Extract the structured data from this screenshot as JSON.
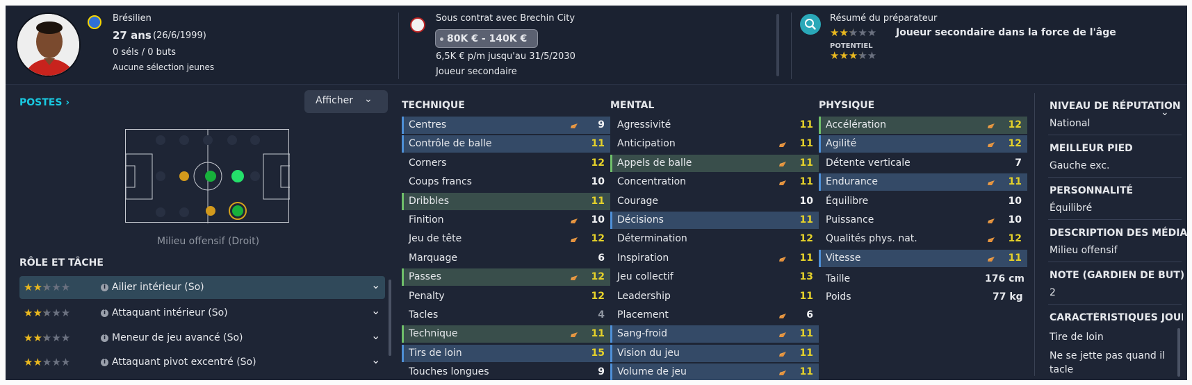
{
  "player": {
    "nationality": "Brésilien",
    "age": "27 ans",
    "dob": "(26/6/1999)",
    "caps": "0 séls / 0 buts",
    "youth": "Aucune sélection jeunes"
  },
  "contract": {
    "status": "Sous contrat avec Brechin City",
    "wage_range": "80K € - 140K €",
    "wage": "6,5K € p/m jusqu'au 31/5/2030",
    "role": "Joueur secondaire"
  },
  "scout": {
    "title": "Résumé du préparateur",
    "summary": "Joueur secondaire dans la force de l'âge",
    "ability_stars": 2.5,
    "potential_label": "POTENTIEL",
    "potential_stars": 3.5
  },
  "positions": {
    "title": "POSTES",
    "show_button": "Afficher",
    "position_label": "Milieu offensif (Droit)"
  },
  "roles": {
    "title": "RÔLE ET TÂCHE",
    "items": [
      {
        "label": "Ailier intérieur (So)",
        "stars": 2.5
      },
      {
        "label": "Attaquant intérieur (So)",
        "stars": 2.5
      },
      {
        "label": "Meneur de jeu avancé (So)",
        "stars": 2.5
      },
      {
        "label": "Attaquant pivot excentré (So)",
        "stars": 2
      }
    ]
  },
  "attributes": {
    "technical": {
      "title": "TECHNIQUE",
      "rows": [
        {
          "name": "Centres",
          "value": "9"
        },
        {
          "name": "Contrôle de balle",
          "value": "11"
        },
        {
          "name": "Corners",
          "value": "12"
        },
        {
          "name": "Coups francs",
          "value": "10"
        },
        {
          "name": "Dribbles",
          "value": "11"
        },
        {
          "name": "Finition",
          "value": "10"
        },
        {
          "name": "Jeu de tête",
          "value": "12"
        },
        {
          "name": "Marquage",
          "value": "6"
        },
        {
          "name": "Passes",
          "value": "12"
        },
        {
          "name": "Penalty",
          "value": "12"
        },
        {
          "name": "Tacles",
          "value": "4"
        },
        {
          "name": "Technique",
          "value": "11"
        },
        {
          "name": "Tirs de loin",
          "value": "15"
        },
        {
          "name": "Touches longues",
          "value": "9"
        }
      ]
    },
    "mental": {
      "title": "MENTAL",
      "rows": [
        {
          "name": "Agressivité",
          "value": "11"
        },
        {
          "name": "Anticipation",
          "value": "11"
        },
        {
          "name": "Appels de balle",
          "value": "11"
        },
        {
          "name": "Concentration",
          "value": "11"
        },
        {
          "name": "Courage",
          "value": "10"
        },
        {
          "name": "Décisions",
          "value": "11"
        },
        {
          "name": "Détermination",
          "value": "12"
        },
        {
          "name": "Inspiration",
          "value": "11"
        },
        {
          "name": "Jeu collectif",
          "value": "13"
        },
        {
          "name": "Leadership",
          "value": "11"
        },
        {
          "name": "Placement",
          "value": "6"
        },
        {
          "name": "Sang-froid",
          "value": "11"
        },
        {
          "name": "Vision du jeu",
          "value": "11"
        },
        {
          "name": "Volume de jeu",
          "value": "11"
        }
      ]
    },
    "physical": {
      "title": "PHYSIQUE",
      "rows": [
        {
          "name": "Accélération",
          "value": "12"
        },
        {
          "name": "Agilité",
          "value": "12"
        },
        {
          "name": "Détente verticale",
          "value": "7"
        },
        {
          "name": "Endurance",
          "value": "11"
        },
        {
          "name": "Équilibre",
          "value": "10"
        },
        {
          "name": "Puissance",
          "value": "10"
        },
        {
          "name": "Qualités phys. nat.",
          "value": "12"
        },
        {
          "name": "Vitesse",
          "value": "11"
        }
      ],
      "height_label": "Taille",
      "height": "176 cm",
      "weight_label": "Poids",
      "weight": "77 kg"
    }
  },
  "info": {
    "reputation_title": "NIVEAU DE RÉPUTATION",
    "reputation": "National",
    "foot_title": "MEILLEUR PIED",
    "foot": "Gauche exc.",
    "personality_title": "PERSONNALITÉ",
    "personality": "Équilibré",
    "media_title": "DESCRIPTION DES MÉDIAS",
    "media": "Milieu offensif",
    "gk_title": "NOTE (GARDIEN DE BUT)",
    "gk": "2",
    "traits_title": "CARACTÉRISTIQUES JOUEU",
    "trait1": "Tire de loin",
    "trait2a": "Ne se jette pas quand il",
    "trait2b": "tacle"
  },
  "colors": {
    "accent_cyan": "#19c8e0",
    "star_gold": "#e9b81f",
    "value_yellow": "#e6d22a",
    "arrow_orange": "#e8913a",
    "highlight_blue": "#344a67",
    "highlight_green": "#394e4b"
  }
}
